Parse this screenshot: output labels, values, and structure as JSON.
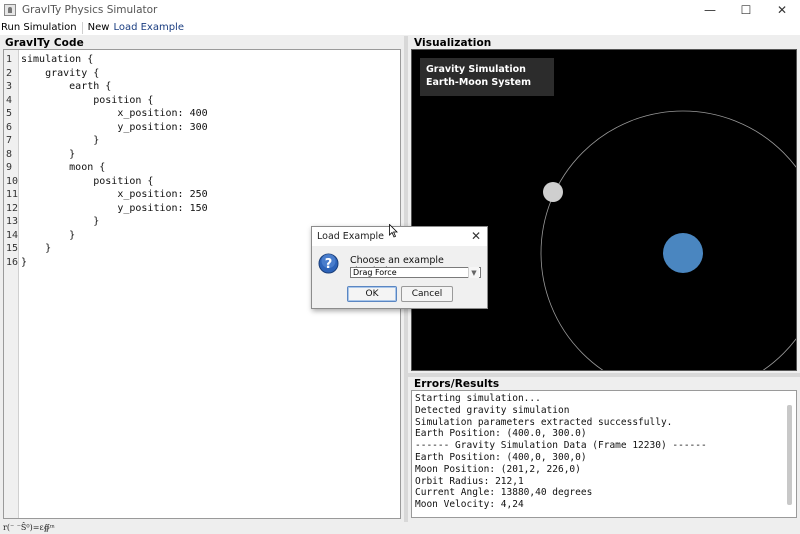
{
  "window": {
    "title": "GravITy Physics Simulator",
    "controls": [
      "—",
      "☐",
      "✕"
    ]
  },
  "menu": {
    "run": "Run Simulation",
    "new": "New",
    "load": "Load Example"
  },
  "code_panel": {
    "title": "GravITy Code",
    "lines": [
      {
        "n": "1",
        "t": "simulation {"
      },
      {
        "n": "2",
        "t": "    gravity {"
      },
      {
        "n": "3",
        "t": "        earth {"
      },
      {
        "n": "4",
        "t": "            position {"
      },
      {
        "n": "5",
        "t": "                x_position: 400"
      },
      {
        "n": "6",
        "t": "                y_position: 300"
      },
      {
        "n": "7",
        "t": "            }"
      },
      {
        "n": "8",
        "t": "        }"
      },
      {
        "n": "9",
        "t": "        moon {"
      },
      {
        "n": "10",
        "t": "            position {"
      },
      {
        "n": "11",
        "t": "                x_position: 250"
      },
      {
        "n": "12",
        "t": "                y_position: 150"
      },
      {
        "n": "13",
        "t": "            }"
      },
      {
        "n": "14",
        "t": "        }"
      },
      {
        "n": "15",
        "t": "    }"
      },
      {
        "n": "16",
        "t": "}"
      }
    ]
  },
  "viz_panel": {
    "title": "Visualization",
    "label_line1": "Gravity Simulation",
    "label_line2": "Earth-Moon System",
    "colors": {
      "earth": "#4a86c0",
      "moon": "#cfcfcf",
      "orbit": "#9a9a9a",
      "background": "#000000"
    }
  },
  "results_panel": {
    "title": "Errors/Results",
    "lines": [
      "Starting simulation...",
      "Detected gravity simulation",
      "Simulation parameters extracted successfully.",
      "Earth Position: (400.0, 300.0)",
      "------ Gravity Simulation Data (Frame 12230) ------",
      "Earth Position: (400,0, 300,0)",
      "Moon Position: (201,2, 226,0)",
      "Orbit Radius: 212,1",
      "Current Angle: 13880,40 degrees",
      "Moon Velocity: 4,24"
    ]
  },
  "status": {
    "text": "r(⁻ ⁻Ŝ⁰)=ε∯ᵐ"
  },
  "dialog": {
    "title": "Load Example",
    "prompt": "Choose an example simulation:",
    "selected": "Drag Force",
    "ok": "OK",
    "cancel": "Cancel"
  }
}
